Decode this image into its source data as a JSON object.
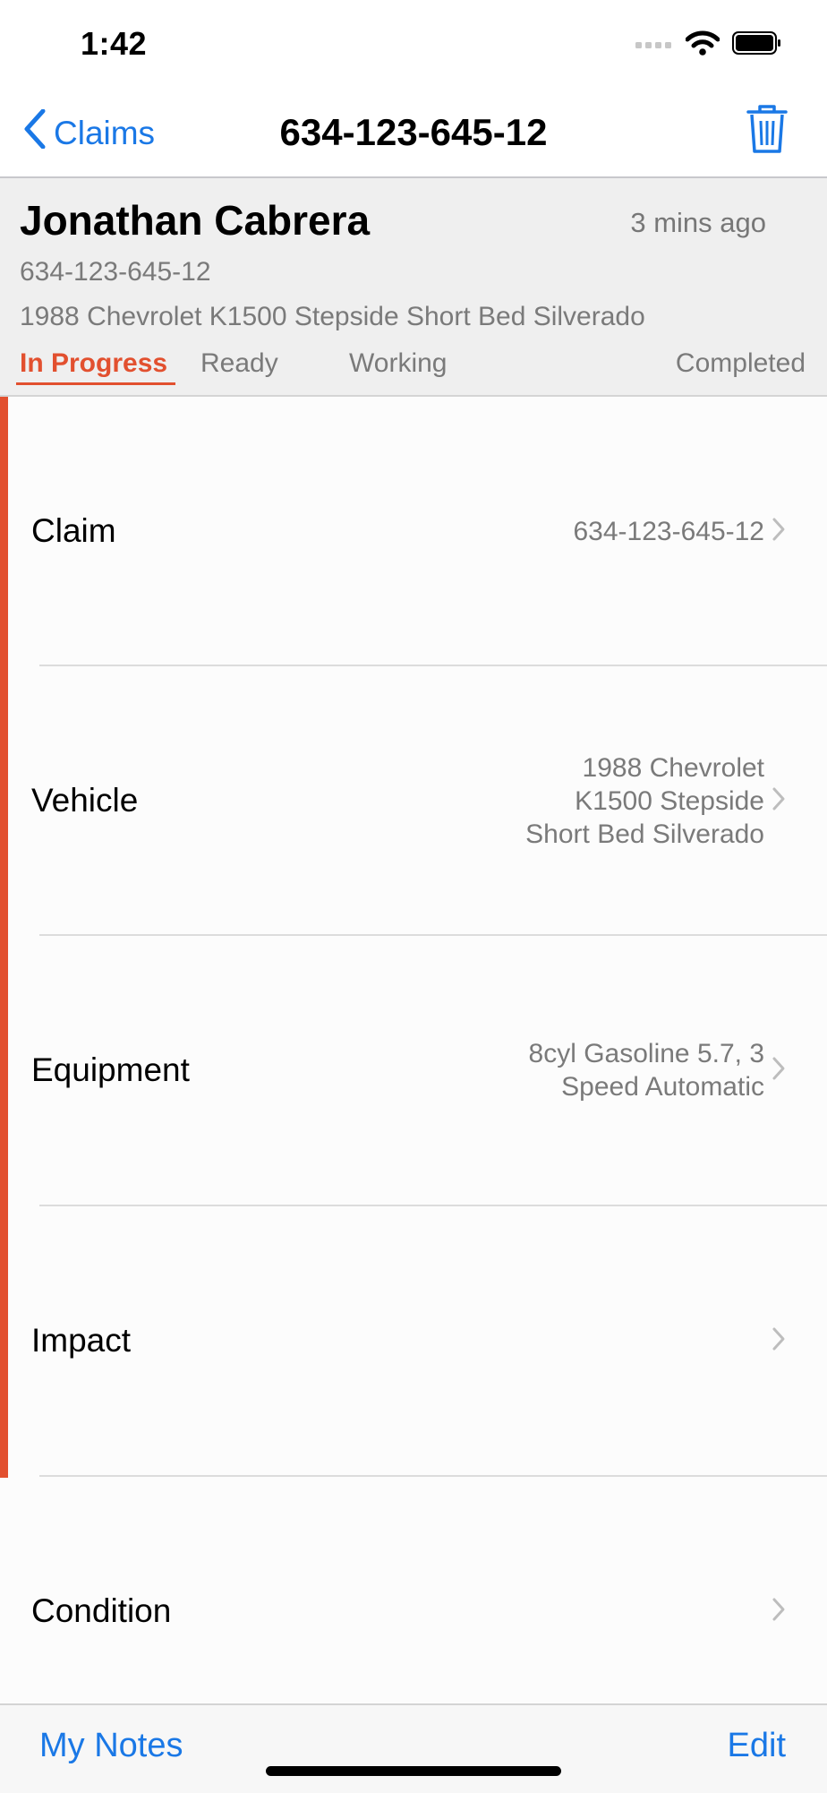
{
  "status_bar": {
    "time": "1:42"
  },
  "nav": {
    "back_label": "Claims",
    "title": "634-123-645-12"
  },
  "header": {
    "name": "Jonathan Cabrera",
    "time_ago": "3 mins ago",
    "claim_number": "634-123-645-12",
    "vehicle": "1988 Chevrolet K1500 Stepside Short Bed Silverado",
    "tabs": [
      "In Progress",
      "Ready",
      "Working",
      "Completed"
    ],
    "active_tab": "In Progress"
  },
  "rows": [
    {
      "label": "Claim",
      "value_lines": [
        "634-123-645-12"
      ]
    },
    {
      "label": "Vehicle",
      "value_lines": [
        "1988 Chevrolet",
        "K1500 Stepside",
        "Short Bed Silverado"
      ]
    },
    {
      "label": "Equipment",
      "value_lines": [
        "8cyl Gasoline 5.7, 3",
        "Speed Automatic"
      ]
    },
    {
      "label": "Impact",
      "value_lines": []
    },
    {
      "label": "Condition",
      "value_lines": []
    }
  ],
  "toolbar": {
    "left_label": "My Notes",
    "right_label": "Edit"
  },
  "colors": {
    "accent": "#e2502f",
    "link": "#1a78e6"
  },
  "icons": [
    "signal-icon",
    "wifi-icon",
    "battery-icon",
    "chevron-left-icon",
    "trash-icon",
    "chevron-right-icon"
  ]
}
